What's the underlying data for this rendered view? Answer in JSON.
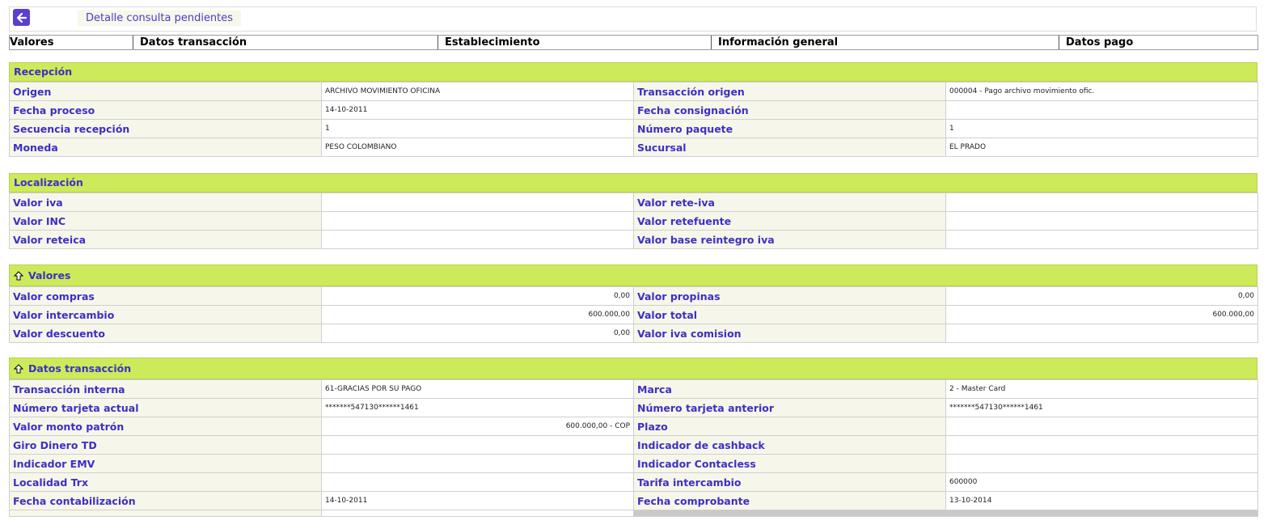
{
  "header": {
    "title": "Detalle consulta pendientes",
    "back_icon": "arrow-left-icon"
  },
  "tabs": [
    "Valores",
    "Datos transacción",
    "Establecimiento",
    "Información general",
    "Datos pago"
  ],
  "sections": {
    "recepcion": {
      "title": "Recepción",
      "rows": [
        {
          "l1": "Origen",
          "v1": "ARCHIVO MOVIMIENTO OFICINA",
          "l2": "Transacción origen",
          "v2": "000004 - Pago archivo movimiento ofic."
        },
        {
          "l1": "Fecha proceso",
          "v1": "14-10-2011",
          "l2": "Fecha consignación",
          "v2": ""
        },
        {
          "l1": "Secuencia recepción",
          "v1": "1",
          "l2": "Número paquete",
          "v2": "1"
        },
        {
          "l1": "Moneda",
          "v1": "PESO COLOMBIANO",
          "l2": "Sucursal",
          "v2": "EL PRADO"
        }
      ]
    },
    "localizacion": {
      "title": "Localización",
      "rows": [
        {
          "l1": "Valor iva",
          "v1": "",
          "l2": "Valor rete-iva",
          "v2": ""
        },
        {
          "l1": "Valor INC",
          "v1": "",
          "l2": "Valor retefuente",
          "v2": ""
        },
        {
          "l1": "Valor reteica",
          "v1": "",
          "l2": "Valor base reintegro iva",
          "v2": ""
        }
      ]
    },
    "valores": {
      "title": "Valores",
      "rows": [
        {
          "l1": "Valor compras",
          "v1": "0,00",
          "l2": "Valor propinas",
          "v2": "0,00"
        },
        {
          "l1": "Valor intercambio",
          "v1": "600.000,00",
          "l2": "Valor total",
          "v2": "600.000,00"
        },
        {
          "l1": "Valor descuento",
          "v1": "0,00",
          "l2": "Valor iva comision",
          "v2": ""
        }
      ]
    },
    "datos_transaccion": {
      "title": "Datos transacción",
      "rows": [
        {
          "l1": "Transacción interna",
          "v1": "61-GRACIAS POR SU PAGO",
          "l2": "Marca",
          "v2": "2 - Master Card"
        },
        {
          "l1": "Número tarjeta actual",
          "v1": "*******547130******1461",
          "l2": "Número tarjeta anterior",
          "v2": "*******547130******1461"
        },
        {
          "l1": "Valor monto patrón",
          "v1": "600.000,00 - COP",
          "l2": "Plazo",
          "v2": ""
        },
        {
          "l1": "Giro Dinero TD",
          "v1": "",
          "l2": "Indicador de cashback",
          "v2": ""
        },
        {
          "l1": "Indicador EMV",
          "v1": "",
          "l2": "Indicador Contacless",
          "v2": ""
        },
        {
          "l1": "Localidad Trx",
          "v1": "",
          "l2": "Tarifa intercambio",
          "v2": "600000"
        },
        {
          "l1": "Fecha contabilización",
          "v1": "14-10-2011",
          "l2": "Fecha comprobante",
          "v2": "13-10-2014"
        }
      ]
    }
  },
  "colors": {
    "accent": "#5b3fd0",
    "section_header": "#cdea5a",
    "label_text": "#3d2fc4"
  }
}
